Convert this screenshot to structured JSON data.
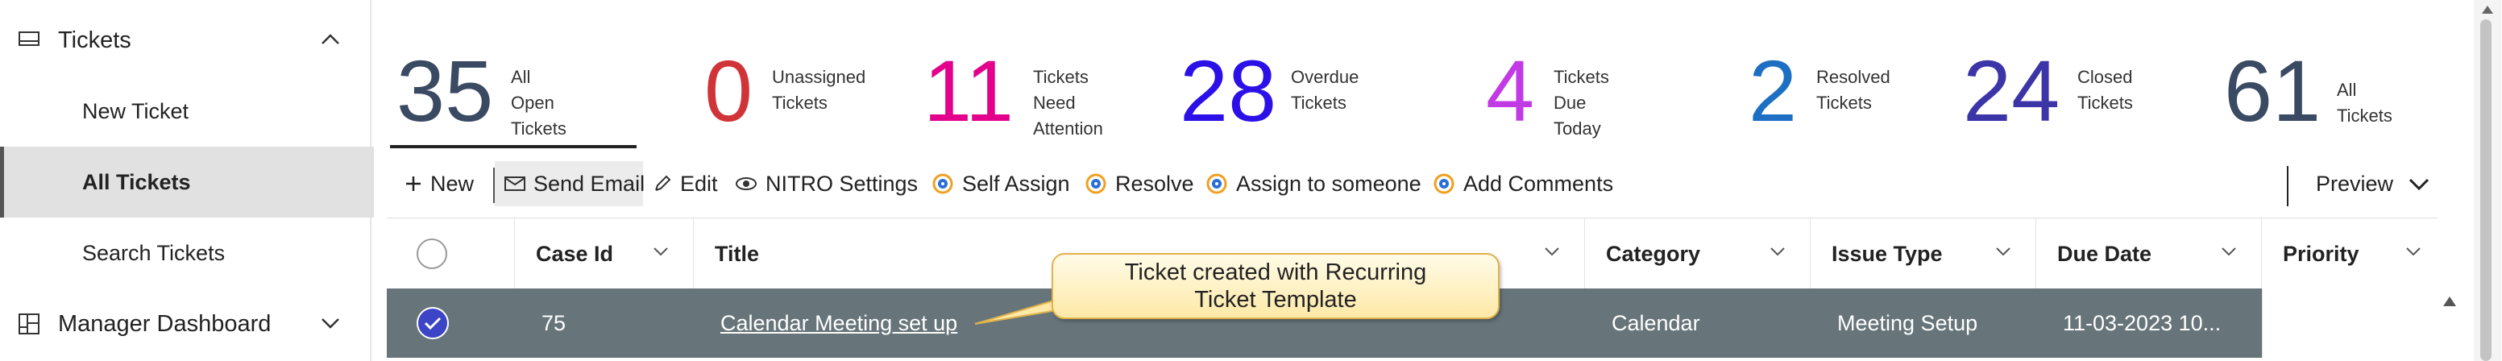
{
  "sidebar": {
    "tickets": {
      "label": "Tickets"
    },
    "items": [
      {
        "label": "New Ticket"
      },
      {
        "label": "All Tickets"
      },
      {
        "label": "Search Tickets"
      }
    ],
    "manager": {
      "label": "Manager Dashboard"
    }
  },
  "stats": [
    {
      "value": "35",
      "label": "All Open\nTickets",
      "color": "#3a4a63"
    },
    {
      "value": "0",
      "label": "Unassigned\nTickets",
      "color": "#d13438"
    },
    {
      "value": "11",
      "label": "Tickets Need\nAttention",
      "color": "#e3008c"
    },
    {
      "value": "28",
      "label": "Overdue\nTickets",
      "color": "#2b10e8"
    },
    {
      "value": "4",
      "label": "Tickets Due\nToday",
      "color": "#c239e6"
    },
    {
      "value": "2",
      "label": "Resolved\nTickets",
      "color": "#1c6fc2"
    },
    {
      "value": "24",
      "label": "Closed\nTickets",
      "color": "#3b35a8"
    },
    {
      "value": "61",
      "label": "All Tickets",
      "color": "#3a4a63"
    }
  ],
  "toolbar": {
    "new": "New",
    "send_email": "Send Email",
    "edit": "Edit",
    "nitro_settings": "NITRO Settings",
    "self_assign": "Self Assign",
    "resolve": "Resolve",
    "assign": "Assign to someone",
    "add_comments": "Add Comments",
    "preview": "Preview"
  },
  "grid": {
    "columns": [
      "Case Id",
      "Title",
      "Category",
      "Issue Type",
      "Due Date",
      "Priority"
    ],
    "rows": [
      {
        "case_id": "75",
        "title": "Calendar Meeting set up",
        "category": "Calendar",
        "issue_type": "Meeting Setup",
        "due_date": "11-03-2023 10...",
        "priority": ""
      }
    ]
  },
  "callout": {
    "text": "Ticket created with Recurring\nTicket Template"
  }
}
